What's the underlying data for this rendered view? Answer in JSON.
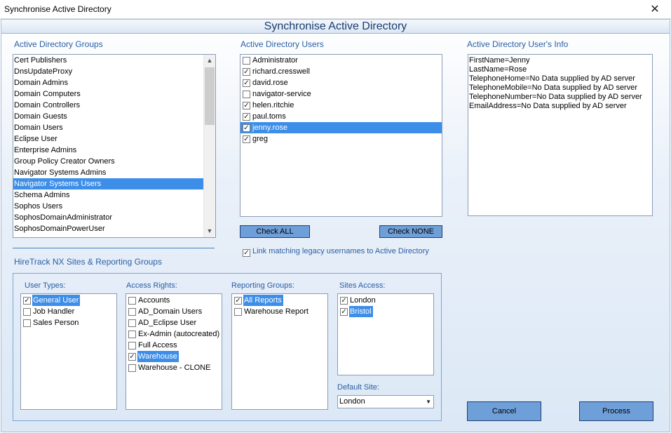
{
  "window": {
    "title": "Synchronise Active Directory",
    "close_glyph": "✕"
  },
  "header": {
    "title": "Synchronise Active Directory"
  },
  "groups_panel": {
    "label": "Active Directory Groups",
    "items": [
      "Cert Publishers",
      "DnsUpdateProxy",
      "Domain Admins",
      "Domain Computers",
      "Domain Controllers",
      "Domain Guests",
      "Domain Users",
      "Eclipse User",
      "Enterprise Admins",
      "Group Policy Creator Owners",
      "Navigator Systems Admins",
      "Navigator Systems Users",
      "Schema Admins",
      "Sophos Users",
      "SophosDomainAdministrator",
      "SophosDomainPowerUser"
    ],
    "selected_index": 11
  },
  "users_panel": {
    "label": "Active Directory Users",
    "items": [
      {
        "name": "Administrator",
        "checked": false
      },
      {
        "name": "richard.cresswell",
        "checked": true
      },
      {
        "name": "david.rose",
        "checked": true
      },
      {
        "name": "navigator-service",
        "checked": false
      },
      {
        "name": "helen.ritchie",
        "checked": true
      },
      {
        "name": "paul.toms",
        "checked": true
      },
      {
        "name": "jenny.rose",
        "checked": true
      },
      {
        "name": "greg",
        "checked": true
      }
    ],
    "selected_index": 6,
    "check_all_label": "Check ALL",
    "check_none_label": "Check NONE",
    "link_label": "Link matching legacy usernames to Active Directory",
    "link_checked": true
  },
  "info_panel": {
    "label": "Active Directory User's Info",
    "lines": [
      "FirstName=Jenny",
      "LastName=Rose",
      "TelephoneHome=No Data supplied by AD server",
      "TelephoneMobile=No Data supplied by AD server",
      "TelephoneNumber=No Data supplied by AD server",
      "EmailAddress=No Data supplied by AD server"
    ]
  },
  "sites_section": {
    "label": "HireTrack NX Sites & Reporting Groups",
    "user_types": {
      "label": "User Types:",
      "items": [
        {
          "name": "General User",
          "checked": true
        },
        {
          "name": "Job Handler",
          "checked": false
        },
        {
          "name": "Sales Person",
          "checked": false
        }
      ],
      "selected_index": 0
    },
    "access_rights": {
      "label": "Access Rights:",
      "items": [
        {
          "name": "Accounts",
          "checked": false
        },
        {
          "name": "AD_Domain Users",
          "checked": false
        },
        {
          "name": "AD_Eclipse User",
          "checked": false
        },
        {
          "name": "Ex-Admin (autocreated)",
          "checked": false
        },
        {
          "name": "Full Access",
          "checked": false
        },
        {
          "name": "Warehouse",
          "checked": true
        },
        {
          "name": "Warehouse - CLONE",
          "checked": false
        }
      ],
      "selected_index": 5
    },
    "reporting_groups": {
      "label": "Reporting Groups:",
      "items": [
        {
          "name": "All Reports",
          "checked": true
        },
        {
          "name": "Warehouse Report",
          "checked": false
        }
      ],
      "selected_index": 0
    },
    "sites_access": {
      "label": "Sites Access:",
      "items": [
        {
          "name": "London",
          "checked": true
        },
        {
          "name": "Bristol",
          "checked": true
        }
      ],
      "selected_index": 1
    },
    "default_site": {
      "label": "Default Site:",
      "value": "London"
    }
  },
  "buttons": {
    "cancel": "Cancel",
    "process": "Process"
  },
  "glyphs": {
    "check": "✓",
    "up": "▲",
    "down": "▼"
  },
  "colors": {
    "selection": "#3d8ee8",
    "button": "#6f9fd8",
    "label": "#2a5ea3"
  }
}
